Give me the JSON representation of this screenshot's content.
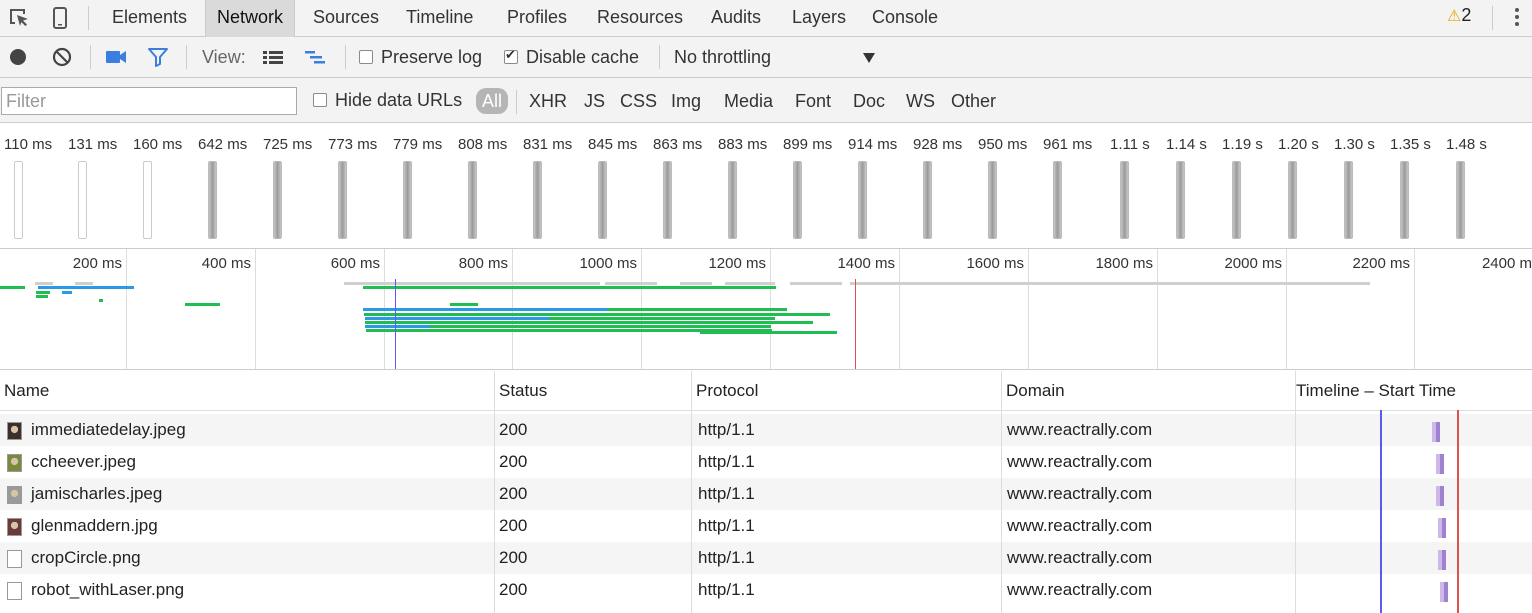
{
  "tabs": [
    "Elements",
    "Network",
    "Sources",
    "Timeline",
    "Profiles",
    "Resources",
    "Audits",
    "Layers",
    "Console"
  ],
  "active_tab": "Network",
  "warnings_count": "2",
  "toolbar": {
    "view_label": "View:",
    "preserve_log_label": "Preserve log",
    "preserve_log_checked": false,
    "disable_cache_label": "Disable cache",
    "disable_cache_checked": true,
    "throttling_value": "No throttling"
  },
  "filter": {
    "placeholder": "Filter",
    "hide_data_urls_label": "Hide data URLs",
    "types": [
      "All",
      "XHR",
      "JS",
      "CSS",
      "Img",
      "Media",
      "Font",
      "Doc",
      "WS",
      "Other"
    ],
    "active_type": "All"
  },
  "frames": [
    "110 ms",
    "131 ms",
    "160 ms",
    "642 ms",
    "725 ms",
    "773 ms",
    "779 ms",
    "808 ms",
    "831 ms",
    "845 ms",
    "863 ms",
    "883 ms",
    "899 ms",
    "914 ms",
    "928 ms",
    "950 ms",
    "961 ms",
    "1.11 s",
    "1.14 s",
    "1.19 s",
    "1.20 s",
    "1.30 s",
    "1.35 s",
    "1.48 s"
  ],
  "overview_ticks": [
    "200 ms",
    "400 ms",
    "600 ms",
    "800 ms",
    "1000 ms",
    "1200 ms",
    "1400 ms",
    "1600 ms",
    "1800 ms",
    "2000 ms",
    "2200 ms",
    "2400 m"
  ],
  "columns": {
    "name": "Name",
    "status": "Status",
    "protocol": "Protocol",
    "domain": "Domain",
    "timeline": "Timeline – Start Time"
  },
  "rows": [
    {
      "name": "immediatedelay.jpeg",
      "status": "200",
      "protocol": "http/1.1",
      "domain": "www.reactrally.com"
    },
    {
      "name": "ccheever.jpeg",
      "status": "200",
      "protocol": "http/1.1",
      "domain": "www.reactrally.com"
    },
    {
      "name": "jamischarles.jpeg",
      "status": "200",
      "protocol": "http/1.1",
      "domain": "www.reactrally.com"
    },
    {
      "name": "glenmaddern.jpg",
      "status": "200",
      "protocol": "http/1.1",
      "domain": "www.reactrally.com"
    },
    {
      "name": "cropCircle.png",
      "status": "200",
      "protocol": "http/1.1",
      "domain": "www.reactrally.com"
    },
    {
      "name": "robot_withLaser.png",
      "status": "200",
      "protocol": "http/1.1",
      "domain": "www.reactrally.com"
    }
  ],
  "colors": {
    "panel_bg": "#f3f3f3",
    "accent_blue": "#3a7ee0",
    "bar_green": "#1fbd52",
    "bar_blue": "#2a9ae8",
    "dom_loaded_line": "#5b5bf0",
    "load_line": "#e05050",
    "timeline_bar": "#b49ae0"
  }
}
